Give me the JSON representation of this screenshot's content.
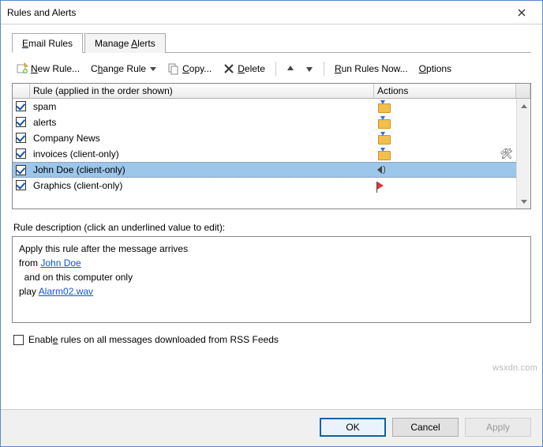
{
  "window": {
    "title": "Rules and Alerts"
  },
  "tabs": [
    {
      "label": "Email Rules",
      "hotkey": "E",
      "active": true
    },
    {
      "label": "Manage Alerts",
      "hotkey": "A",
      "active": false
    }
  ],
  "toolbar": {
    "new_rule": "New Rule...",
    "change_rule": "Change Rule",
    "copy": "Copy...",
    "delete": "Delete",
    "run_rules": "Run Rules Now...",
    "options": "Options"
  },
  "list": {
    "header_rule": "Rule (applied in the order shown)",
    "header_actions": "Actions",
    "rows": [
      {
        "checked": true,
        "name": "spam",
        "actions": [
          "folder"
        ],
        "selected": false
      },
      {
        "checked": true,
        "name": "alerts",
        "actions": [
          "folder"
        ],
        "selected": false
      },
      {
        "checked": true,
        "name": "Company News",
        "actions": [
          "folder"
        ],
        "selected": false
      },
      {
        "checked": true,
        "name": "invoices  (client-only)",
        "actions": [
          "folder"
        ],
        "tools": true,
        "selected": false
      },
      {
        "checked": true,
        "name": "John Doe  (client-only)",
        "actions": [
          "sound"
        ],
        "selected": true
      },
      {
        "checked": true,
        "name": "Graphics  (client-only)",
        "actions": [
          "flag"
        ],
        "selected": false
      }
    ]
  },
  "description": {
    "label": "Rule description (click an underlined value to edit):",
    "line1": "Apply this rule after the message arrives",
    "line2_prefix": "from ",
    "line2_link": "John Doe",
    "line3": "  and on this computer only",
    "line4_prefix": "play ",
    "line4_link": "Alarm02.wav"
  },
  "rss": {
    "checked": false,
    "label": "Enable rules on all messages downloaded from RSS Feeds"
  },
  "buttons": {
    "ok": "OK",
    "cancel": "Cancel",
    "apply": "Apply"
  },
  "watermark": "wsxdn.com"
}
